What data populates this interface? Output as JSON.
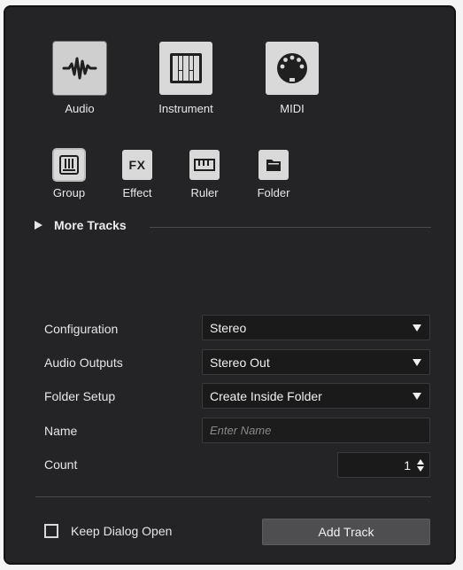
{
  "track_types": {
    "primary": [
      {
        "id": "audio",
        "label": "Audio",
        "icon": "waveform-icon",
        "selected": true
      },
      {
        "id": "instrument",
        "label": "Instrument",
        "icon": "piano-keys-icon",
        "selected": false
      },
      {
        "id": "midi",
        "label": "MIDI",
        "icon": "midi-connector-icon",
        "selected": false
      }
    ],
    "secondary": [
      {
        "id": "group",
        "label": "Group",
        "icon": "group-fader-icon"
      },
      {
        "id": "effect",
        "label": "Effect",
        "icon": "fx-icon",
        "icon_text": "FX"
      },
      {
        "id": "ruler",
        "label": "Ruler",
        "icon": "ruler-icon"
      },
      {
        "id": "folder",
        "label": "Folder",
        "icon": "folder-icon"
      }
    ]
  },
  "more_tracks": {
    "label": "More Tracks",
    "expanded": false
  },
  "form": {
    "configuration": {
      "label": "Configuration",
      "value": "Stereo"
    },
    "audio_outputs": {
      "label": "Audio Outputs",
      "value": "Stereo Out"
    },
    "folder_setup": {
      "label": "Folder Setup",
      "value": "Create Inside Folder"
    },
    "name": {
      "label": "Name",
      "value": "",
      "placeholder": "Enter Name"
    },
    "count": {
      "label": "Count",
      "value": "1"
    }
  },
  "footer": {
    "keep_open_label": "Keep Dialog Open",
    "keep_open_checked": false,
    "add_track_label": "Add Track"
  },
  "colors": {
    "dialog_bg": "#242426",
    "tile_bg": "#d9d9d9",
    "icon_dark": "#1f1f1f",
    "field_bg": "#1a1a1b",
    "button_bg": "#4e4e50"
  }
}
